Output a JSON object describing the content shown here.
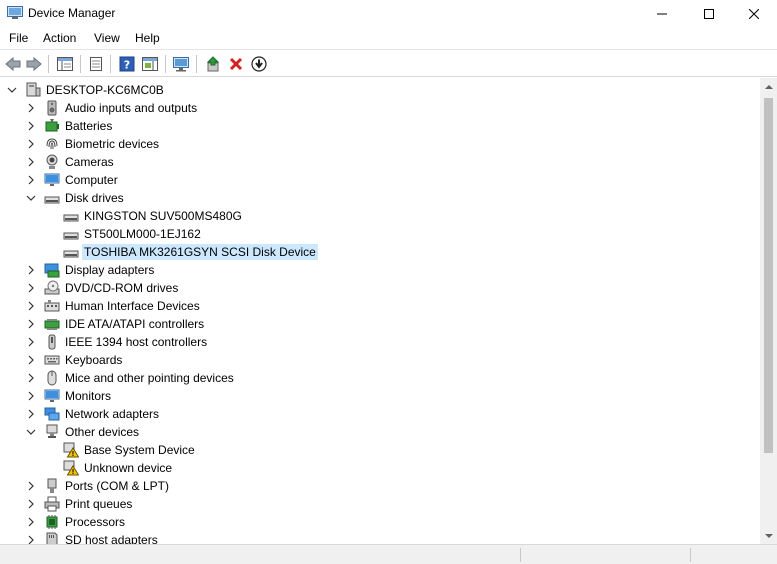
{
  "window": {
    "title": "Device Manager",
    "icon": "device-manager-icon"
  },
  "menu": [
    {
      "label": "File"
    },
    {
      "label": "Action"
    },
    {
      "label": "View"
    },
    {
      "label": "Help"
    }
  ],
  "toolbar": [
    "back-arrow-icon",
    "forward-arrow-icon",
    "show-hide-console-tree-icon",
    "properties-icon",
    "help-icon",
    "action-pane-icon",
    "scan-hardware-icon",
    "update-driver-icon",
    "uninstall-device-icon",
    "disable-device-icon"
  ],
  "tree": {
    "root": {
      "label": "DESKTOP-KC6MC0B",
      "expanded": true
    },
    "items": [
      {
        "label": "Audio inputs and outputs",
        "icon": "audio-icon",
        "level": 1,
        "expander": "collapsed"
      },
      {
        "label": "Batteries",
        "icon": "battery-icon",
        "level": 1,
        "expander": "collapsed"
      },
      {
        "label": "Biometric devices",
        "icon": "fingerprint-icon",
        "level": 1,
        "expander": "collapsed"
      },
      {
        "label": "Cameras",
        "icon": "camera-icon",
        "level": 1,
        "expander": "collapsed"
      },
      {
        "label": "Computer",
        "icon": "monitor-icon",
        "level": 1,
        "expander": "collapsed"
      },
      {
        "label": "Disk drives",
        "icon": "disk-drive-icon",
        "level": 1,
        "expander": "expanded"
      },
      {
        "label": "KINGSTON SUV500MS480G",
        "icon": "disk-drive-icon",
        "level": 2,
        "expander": "none"
      },
      {
        "label": "ST500LM000-1EJ162",
        "icon": "disk-drive-icon",
        "level": 2,
        "expander": "none"
      },
      {
        "label": "TOSHIBA MK3261GSYN SCSI Disk Device",
        "icon": "disk-drive-icon",
        "level": 2,
        "expander": "none",
        "selected": true
      },
      {
        "label": "Display adapters",
        "icon": "display-adapter-icon",
        "level": 1,
        "expander": "collapsed"
      },
      {
        "label": "DVD/CD-ROM drives",
        "icon": "dvd-icon",
        "level": 1,
        "expander": "collapsed"
      },
      {
        "label": "Human Interface Devices",
        "icon": "hid-icon",
        "level": 1,
        "expander": "collapsed"
      },
      {
        "label": "IDE ATA/ATAPI controllers",
        "icon": "ide-controller-icon",
        "level": 1,
        "expander": "collapsed"
      },
      {
        "label": "IEEE 1394 host controllers",
        "icon": "ieee1394-icon",
        "level": 1,
        "expander": "collapsed"
      },
      {
        "label": "Keyboards",
        "icon": "keyboard-icon",
        "level": 1,
        "expander": "collapsed"
      },
      {
        "label": "Mice and other pointing devices",
        "icon": "mouse-icon",
        "level": 1,
        "expander": "collapsed"
      },
      {
        "label": "Monitors",
        "icon": "monitor-icon",
        "level": 1,
        "expander": "collapsed"
      },
      {
        "label": "Network adapters",
        "icon": "network-adapter-icon",
        "level": 1,
        "expander": "collapsed"
      },
      {
        "label": "Other devices",
        "icon": "other-devices-icon",
        "level": 1,
        "expander": "expanded"
      },
      {
        "label": "Base System Device",
        "icon": "warning-device-icon",
        "level": 2,
        "expander": "none"
      },
      {
        "label": "Unknown device",
        "icon": "warning-device-icon",
        "level": 2,
        "expander": "none"
      },
      {
        "label": "Ports (COM & LPT)",
        "icon": "port-icon",
        "level": 1,
        "expander": "collapsed"
      },
      {
        "label": "Print queues",
        "icon": "printer-icon",
        "level": 1,
        "expander": "collapsed"
      },
      {
        "label": "Processors",
        "icon": "processor-icon",
        "level": 1,
        "expander": "collapsed"
      },
      {
        "label": "SD host adapters",
        "icon": "sd-adapter-icon",
        "level": 1,
        "expander": "collapsed"
      }
    ]
  },
  "colors": {
    "selection": "#cce8ff",
    "accent_blue": "#2d7fd6",
    "delete_red": "#d42020",
    "update_green": "#2a9a3a",
    "warning_yellow": "#f5c400"
  }
}
